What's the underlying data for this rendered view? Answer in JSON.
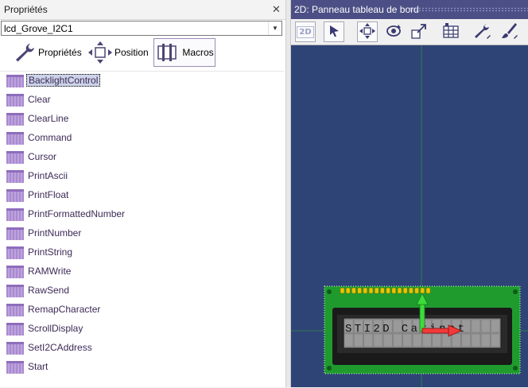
{
  "properties_panel": {
    "title": "Propriétés",
    "close_glyph": "✕",
    "component_name": "lcd_Grove_I2C1",
    "tabs": [
      {
        "label": "Propriétés",
        "icon": "wrench-icon"
      },
      {
        "label": "Position",
        "icon": "move-arrows-icon"
      },
      {
        "label": "Macros",
        "icon": "macro-block-icon",
        "active": true
      }
    ],
    "macros": [
      {
        "label": "BacklightControl",
        "selected": true
      },
      {
        "label": "Clear"
      },
      {
        "label": "ClearLine"
      },
      {
        "label": "Command"
      },
      {
        "label": "Cursor"
      },
      {
        "label": "PrintAscii"
      },
      {
        "label": "PrintFloat"
      },
      {
        "label": "PrintFormattedNumber"
      },
      {
        "label": "PrintNumber"
      },
      {
        "label": "PrintString"
      },
      {
        "label": "RAMWrite"
      },
      {
        "label": "RawSend"
      },
      {
        "label": "RemapCharacter"
      },
      {
        "label": "ScrollDisplay"
      },
      {
        "label": "SetI2CAddress"
      },
      {
        "label": "Start"
      }
    ]
  },
  "dashboard_panel": {
    "title": "2D: Panneau tableau de bord",
    "toolbar_2d_label": "2D",
    "lcd_display_text": "STI2D Carinet"
  },
  "colors": {
    "macro_icon": "#a98ad0",
    "canvas_bg": "#2f4476",
    "title_bar": "#4b4f85",
    "pcb_green": "#1f9b2e",
    "lcd_bg": "#8a8a8a"
  }
}
